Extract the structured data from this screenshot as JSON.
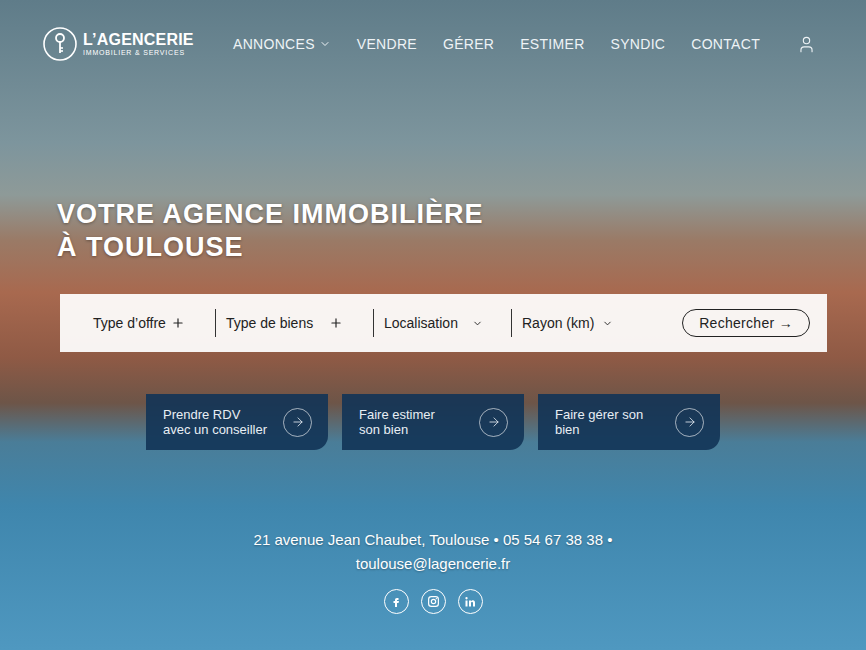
{
  "header": {
    "logo": {
      "name": "L’AGENCERIE",
      "tagline": "IMMOBILIER & SERVICES"
    },
    "nav": [
      {
        "label": "ANNONCES",
        "dropdown": true
      },
      {
        "label": "VENDRE",
        "dropdown": false
      },
      {
        "label": "GÉRER",
        "dropdown": false
      },
      {
        "label": "ESTIMER",
        "dropdown": false
      },
      {
        "label": "SYNDIC",
        "dropdown": false
      },
      {
        "label": "CONTACT",
        "dropdown": false
      }
    ]
  },
  "hero": {
    "title_lines": [
      "VOTRE AGENCE IMMOBILIÈRE",
      "À TOULOUSE"
    ]
  },
  "search": {
    "fields": [
      {
        "label": "Type d’offre",
        "kind": "plus"
      },
      {
        "label": "Type de biens",
        "kind": "plus"
      },
      {
        "label": "Localisation",
        "kind": "select"
      },
      {
        "label": "Rayon (km)",
        "kind": "select"
      }
    ],
    "button": "Rechercher →"
  },
  "actions": [
    {
      "lines": [
        "Prendre RDV",
        "avec un conseiller"
      ]
    },
    {
      "lines": [
        "Faire estimer",
        "son bien"
      ]
    },
    {
      "lines": [
        "Faire gérer son",
        "bien"
      ]
    }
  ],
  "contact": {
    "line1": "21 avenue Jean Chaubet, Toulouse • 05 54 67 38 38 •",
    "line2": "toulouse@lagencerie.fr"
  }
}
